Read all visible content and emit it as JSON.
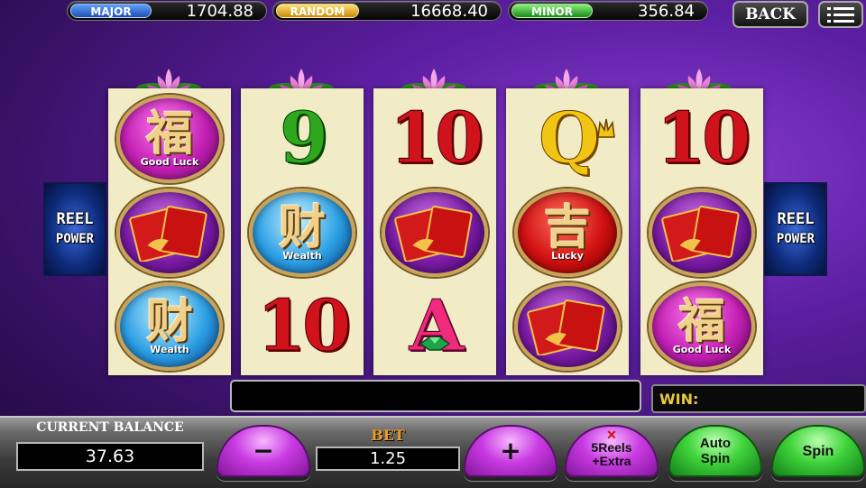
{
  "jackpots": [
    {
      "label": "MAJOR",
      "value": "1704.88",
      "color": "#1f5fc8"
    },
    {
      "label": "RANDOM",
      "value": "16668.40",
      "color": "#e3a00c"
    },
    {
      "label": "MINOR",
      "value": "356.84",
      "color": "#27b02a"
    }
  ],
  "header": {
    "back_label": "BACK",
    "menu_icon": "menu-icon"
  },
  "reel_power": {
    "line1": "REEL",
    "line2": "POWER"
  },
  "symbols": {
    "good_luck_glyph": "福",
    "good_luck_caption": "Good Luck",
    "wealth_glyph": "财",
    "wealth_caption": "Wealth",
    "lucky_glyph": "吉",
    "lucky_caption": "Lucky",
    "nine": "9",
    "ten": "10",
    "queen": "Q",
    "ace": "A"
  },
  "win": {
    "label": "WIN:",
    "value": ""
  },
  "message": "",
  "balance": {
    "label": "CURRENT BALANCE",
    "value": "37.63"
  },
  "bet": {
    "label": "BET",
    "value": "1.25"
  },
  "buttons": {
    "minus": "−",
    "plus": "+",
    "reels_extra": "5Reels\n+Extra",
    "auto_spin": "Auto\nSpin",
    "spin": "Spin"
  },
  "colors": {
    "reel_bg": "#f1ecc6",
    "label_gold": "#e9c940",
    "bet_orange": "#f29b1e"
  }
}
